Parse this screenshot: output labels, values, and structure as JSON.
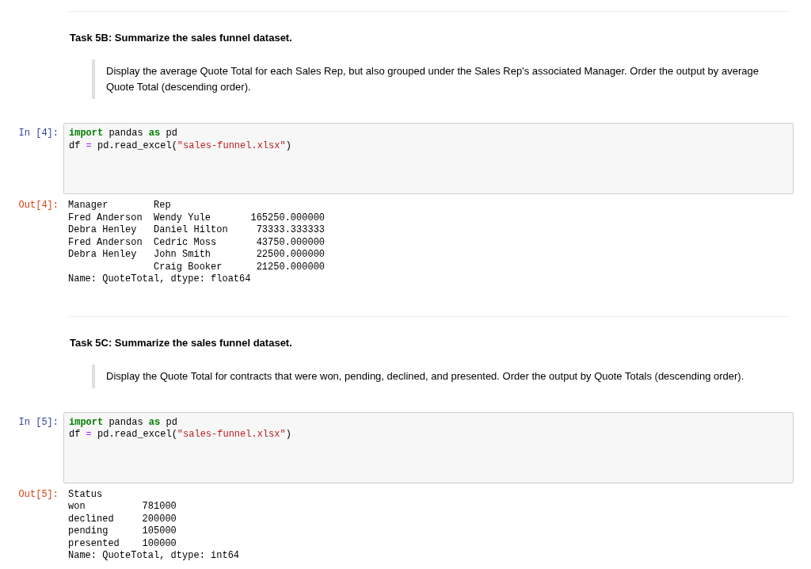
{
  "cells": [
    {
      "kind": "markdown",
      "heading": "Task 5B: Summarize the sales funnel dataset.",
      "quote": "Display the average Quote Total for each Sales Rep, but also grouped under the Sales Rep's associated Manager. Order the output by average Quote Total (descending order)."
    },
    {
      "kind": "input",
      "prompt": "In [4]:",
      "lines": [
        [
          {
            "kind": "keyword",
            "text": "import"
          },
          {
            "kind": "plain",
            "text": " pandas "
          },
          {
            "kind": "keyword",
            "text": "as"
          },
          {
            "kind": "plain",
            "text": " pd"
          }
        ],
        [
          {
            "kind": "plain",
            "text": "df "
          },
          {
            "kind": "operator",
            "text": "="
          },
          {
            "kind": "plain",
            "text": " pd.read_excel("
          },
          {
            "kind": "string",
            "text": "\"sales-funnel.xlsx\""
          },
          {
            "kind": "plain",
            "text": ")"
          }
        ]
      ]
    },
    {
      "kind": "output",
      "prompt": "Out[4]:",
      "lines": [
        "Manager        Rep",
        "Fred Anderson  Wendy Yule       165250.000000",
        "Debra Henley   Daniel Hilton     73333.333333",
        "Fred Anderson  Cedric Moss       43750.000000",
        "Debra Henley   John Smith        22500.000000",
        "               Craig Booker      21250.000000",
        "Name: QuoteTotal, dtype: float64"
      ]
    },
    {
      "kind": "markdown",
      "heading": "Task 5C: Summarize the sales funnel dataset.",
      "quote": "Display the Quote Total for contracts that were won, pending, declined, and presented. Order the output by Quote Totals (descending order)."
    },
    {
      "kind": "input",
      "prompt": "In [5]:",
      "lines": [
        [
          {
            "kind": "keyword",
            "text": "import"
          },
          {
            "kind": "plain",
            "text": " pandas "
          },
          {
            "kind": "keyword",
            "text": "as"
          },
          {
            "kind": "plain",
            "text": " pd"
          }
        ],
        [
          {
            "kind": "plain",
            "text": "df "
          },
          {
            "kind": "operator",
            "text": "="
          },
          {
            "kind": "plain",
            "text": " pd.read_excel("
          },
          {
            "kind": "string",
            "text": "\"sales-funnel.xlsx\""
          },
          {
            "kind": "plain",
            "text": ")"
          }
        ]
      ]
    },
    {
      "kind": "output",
      "prompt": "Out[5]:",
      "lines": [
        "Status",
        "won          781000",
        "declined     200000",
        "pending      105000",
        "presented    100000",
        "Name: QuoteTotal, dtype: int64"
      ]
    }
  ]
}
